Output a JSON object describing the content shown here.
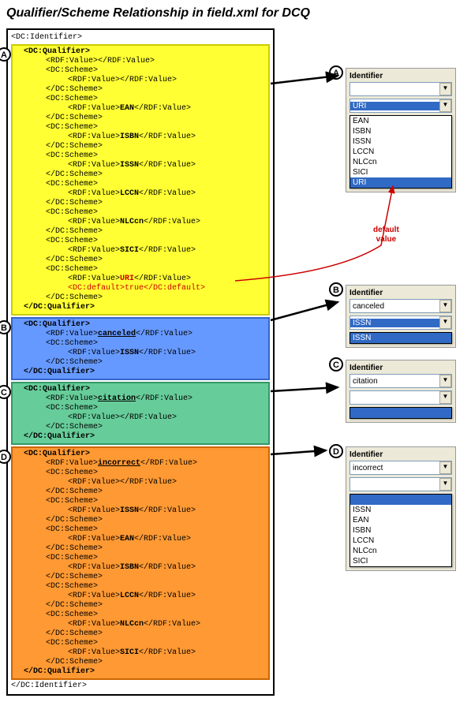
{
  "title": "Qualifier/Scheme Relationship in field.xml for DCQ",
  "tags": {
    "identifier_open": "<DC:Identifier>",
    "identifier_close": "</DC:Identifier>",
    "qualifier_open": "<DC:Qualifier>",
    "qualifier_close": "</DC:Qualifier>",
    "rdf_empty": "<RDF:Value></RDF:Value>",
    "rdf_open": "<RDF:Value>",
    "rdf_close": "</RDF:Value>",
    "scheme_open": "<DC:Scheme>",
    "scheme_close": "</DC:Scheme>",
    "default_open": "<DC:default>",
    "default_close": "</DC:default>",
    "true": "true"
  },
  "blockA": {
    "badge": "A",
    "schemes": [
      "EAN",
      "ISBN",
      "ISSN",
      "LCCN",
      "NLCcn",
      "SICI",
      "URI"
    ]
  },
  "blockB": {
    "badge": "B",
    "qualifier": "canceled",
    "scheme": "ISSN"
  },
  "blockC": {
    "badge": "C",
    "qualifier": "citation"
  },
  "blockD": {
    "badge": "D",
    "qualifier": "incorrect",
    "schemes": [
      "ISSN",
      "EAN",
      "ISBN",
      "LCCN",
      "NLCcn",
      "SICI"
    ]
  },
  "panels": {
    "label": "Identifier",
    "a": {
      "badge": "A",
      "top_value": "",
      "selected": "URI",
      "options": [
        "EAN",
        "ISBN",
        "ISSN",
        "LCCN",
        "NLCcn",
        "SICI",
        "URI"
      ]
    },
    "b": {
      "badge": "B",
      "top_value": "canceled",
      "selected": "ISSN",
      "options": [
        "ISSN"
      ]
    },
    "c": {
      "badge": "C",
      "top_value": "citation",
      "selected": ""
    },
    "d": {
      "badge": "D",
      "top_value": "incorrect",
      "selected": "",
      "options": [
        "ISSN",
        "EAN",
        "ISBN",
        "LCCN",
        "NLCcn",
        "SICI"
      ]
    }
  },
  "default_label": "default value",
  "arrow": "▼"
}
